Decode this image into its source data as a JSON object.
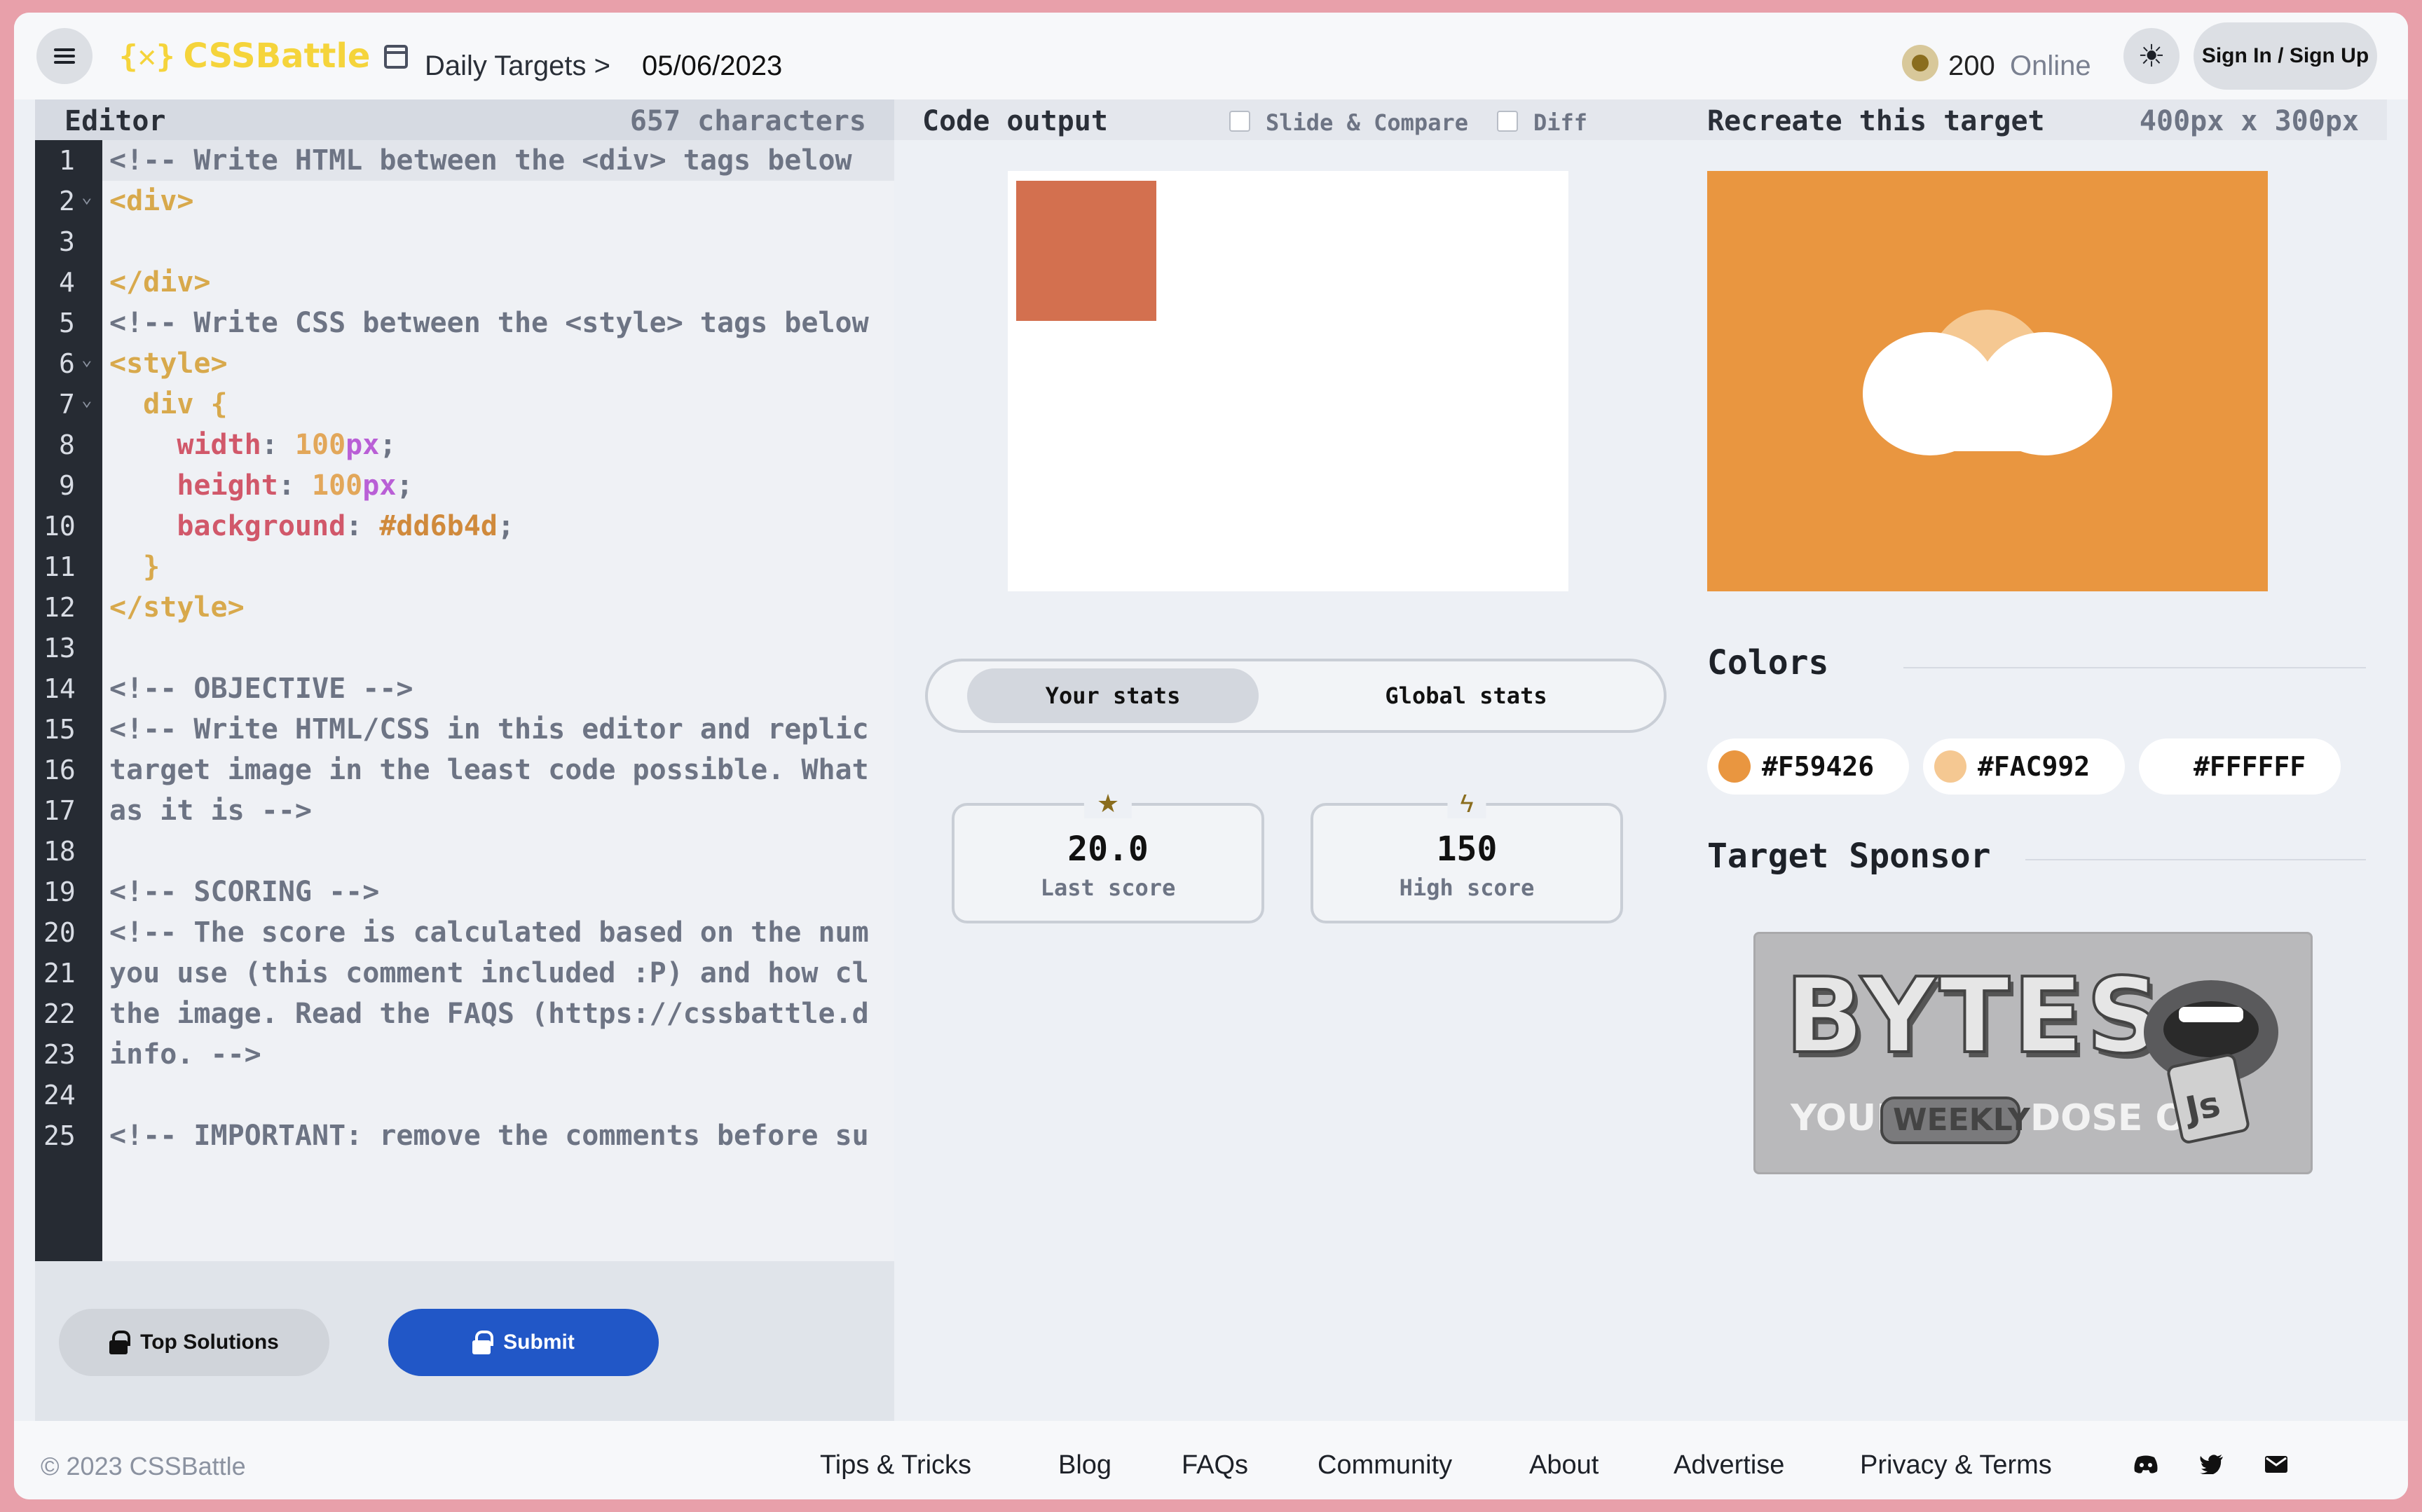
{
  "header": {
    "menu_icon": "hamburger-icon",
    "logo_mark": "{✕}",
    "logo_text": "CSSBattle",
    "breadcrumb": "Daily Targets >",
    "date": "05/06/2023",
    "points": "200",
    "online_label": "Online",
    "theme_icon": "sun-icon",
    "signin_label": "Sign In / Sign Up"
  },
  "editor": {
    "title": "Editor",
    "char_count": "657 characters",
    "line_numbers": [
      "1",
      "2",
      "3",
      "4",
      "5",
      "6",
      "7",
      "8",
      "9",
      "10",
      "11",
      "12",
      "13",
      "14",
      "15",
      "16",
      "17",
      "18",
      "19",
      "20",
      "21",
      "22",
      "23",
      "24",
      "25"
    ],
    "lines": {
      "l1": "<!-- Write HTML between the <div> tags below",
      "l2": "<div>",
      "l4": "</div>",
      "l5": "<!-- Write CSS between the <style> tags below",
      "l6": "<style>",
      "l7a": "  div",
      "l7b": " {",
      "l8a": "    width",
      "l8b": ": ",
      "l8c": "100",
      "l8d": "px",
      "l8e": ";",
      "l9a": "    height",
      "l9b": ": ",
      "l9c": "100",
      "l9d": "px",
      "l9e": ";",
      "l10a": "    background",
      "l10b": ": ",
      "l10c": "#dd6b4d",
      "l10d": ";",
      "l11": "  }",
      "l12": "</style>",
      "l14": "<!-- OBJECTIVE -->",
      "l15": "<!-- Write HTML/CSS in this editor and replic",
      "l16": "target image in the least code possible. What",
      "l17": "as it is -->",
      "l19": "<!-- SCORING -->",
      "l20": "<!-- The score is calculated based on the num",
      "l21": "you use (this comment included :P) and how cl",
      "l22": "the image. Read the FAQS (https://cssbattle.d",
      "l23": "info. -->",
      "l25": "<!-- IMPORTANT: remove the comments before su"
    },
    "top_solutions_label": "Top Solutions",
    "submit_label": "Submit"
  },
  "output": {
    "title": "Code output",
    "slide_compare_label": "Slide & Compare",
    "diff_label": "Diff",
    "tab_your_stats": "Your stats",
    "tab_global_stats": "Global stats",
    "last_score_value": "20.0",
    "last_score_label": "Last score",
    "high_score_value": "150",
    "high_score_label": "High score",
    "last_score_icon": "star-icon",
    "high_score_icon": "bolt-icon"
  },
  "target": {
    "title": "Recreate this target",
    "size": "400px x 300px",
    "colors_title": "Colors",
    "colors": [
      {
        "hex": "#F59426",
        "label": "#F59426"
      },
      {
        "hex": "#FAC992",
        "label": "#FAC992"
      },
      {
        "hex": "#FFFFFF",
        "label": "#FFFFFF"
      }
    ],
    "sponsor_title": "Target Sponsor",
    "sponsor": {
      "big": "BYTES",
      "your": "YOUR",
      "weekly": "WEEKLY",
      "dose": "DOSE OF",
      "js": "Js"
    }
  },
  "footer": {
    "copyright": "© 2023 CSSBattle",
    "links": [
      "Tips & Tricks",
      "Blog",
      "FAQs",
      "Community",
      "About",
      "Advertise",
      "Privacy & Terms"
    ],
    "icons": [
      "discord-icon",
      "twitter-icon",
      "mail-icon"
    ]
  },
  "theme": {
    "accent_blue": "#2157c7",
    "logo_yellow": "#f5d43b",
    "target_bg": "#e99640",
    "output_square": "#d3704f"
  }
}
